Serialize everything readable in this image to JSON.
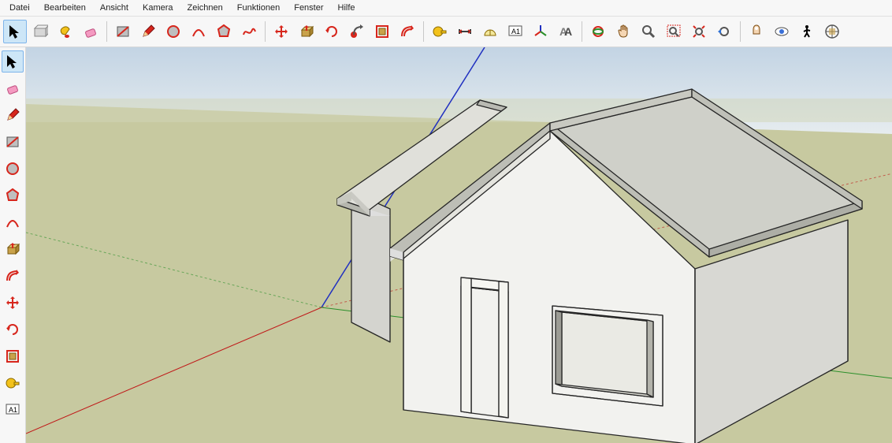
{
  "menu": {
    "items": [
      "Datei",
      "Bearbeiten",
      "Ansicht",
      "Kamera",
      "Zeichnen",
      "Funktionen",
      "Fenster",
      "Hilfe"
    ]
  },
  "toolbar_top": {
    "groups": [
      [
        {
          "name": "select-tool",
          "icon": "cursor",
          "selected": true
        },
        {
          "name": "make-component",
          "icon": "component"
        },
        {
          "name": "paint-bucket-tool",
          "icon": "paint"
        },
        {
          "name": "eraser-tool",
          "icon": "eraser"
        }
      ],
      [
        {
          "name": "rectangle-tool",
          "icon": "rect-diag"
        },
        {
          "name": "line-tool",
          "icon": "pencil"
        },
        {
          "name": "circle-tool",
          "icon": "circle-red"
        },
        {
          "name": "arc-tool",
          "icon": "arc"
        },
        {
          "name": "polygon-tool",
          "icon": "polygon"
        },
        {
          "name": "freehand-tool",
          "icon": "freehand"
        }
      ],
      [
        {
          "name": "move-tool",
          "icon": "move"
        },
        {
          "name": "push-pull-tool",
          "icon": "pushpull"
        },
        {
          "name": "rotate-tool",
          "icon": "rotate"
        },
        {
          "name": "follow-me-tool",
          "icon": "followme"
        },
        {
          "name": "scale-tool",
          "icon": "scale"
        },
        {
          "name": "offset-tool",
          "icon": "offset"
        }
      ],
      [
        {
          "name": "tape-measure-tool",
          "icon": "tape"
        },
        {
          "name": "dimension-tool",
          "icon": "dimension"
        },
        {
          "name": "protractor-tool",
          "icon": "protractor"
        },
        {
          "name": "text-tool",
          "icon": "text"
        },
        {
          "name": "axes-tool",
          "icon": "axes"
        },
        {
          "name": "3d-text-tool",
          "icon": "3dtext"
        }
      ],
      [
        {
          "name": "orbit-tool",
          "icon": "orbit"
        },
        {
          "name": "pan-tool",
          "icon": "pan"
        },
        {
          "name": "zoom-tool",
          "icon": "zoom"
        },
        {
          "name": "zoom-window-tool",
          "icon": "zoomwin"
        },
        {
          "name": "zoom-extents-tool",
          "icon": "zoomext"
        },
        {
          "name": "previous-view",
          "icon": "prevview"
        }
      ],
      [
        {
          "name": "position-camera",
          "icon": "poscam"
        },
        {
          "name": "look-around",
          "icon": "lookaround"
        },
        {
          "name": "walk-tool",
          "icon": "walk"
        },
        {
          "name": "section-plane",
          "icon": "section"
        }
      ]
    ]
  },
  "toolbar_left": {
    "items": [
      {
        "name": "select-tool",
        "icon": "cursor",
        "selected": true
      },
      {
        "name": "eraser-tool",
        "icon": "eraser"
      },
      {
        "name": "line-tool",
        "icon": "pencil"
      },
      {
        "name": "rectangle-tool",
        "icon": "rect-diag"
      },
      {
        "name": "circle-tool",
        "icon": "circle-red"
      },
      {
        "name": "polygon-tool",
        "icon": "polygon"
      },
      {
        "name": "arc-tool",
        "icon": "arc"
      },
      {
        "name": "push-pull-tool",
        "icon": "pushpull"
      },
      {
        "name": "offset-tool",
        "icon": "offset"
      },
      {
        "name": "move-tool",
        "icon": "move"
      },
      {
        "name": "rotate-tool",
        "icon": "rotate"
      },
      {
        "name": "scale-tool",
        "icon": "scale"
      },
      {
        "name": "tape-measure-tool",
        "icon": "tape"
      },
      {
        "name": "text-tool",
        "icon": "text"
      }
    ]
  },
  "colors": {
    "sky_top": "#d6e2ed",
    "sky_bot": "#e8edf0",
    "ground": "#c9cba4",
    "axis_red": "#c01818",
    "axis_green": "#2a8f2a",
    "axis_blue": "#2030c0",
    "wall_light": "#f4f4f2",
    "wall_mid": "#e2e2df",
    "wall_dark": "#cfcfca",
    "roof": "#d7d8d2",
    "roof_dark": "#b7b8b2",
    "tool_red": "#d7261c",
    "tool_yellow": "#f3c21b",
    "tool_gray": "#7c7c7c"
  }
}
